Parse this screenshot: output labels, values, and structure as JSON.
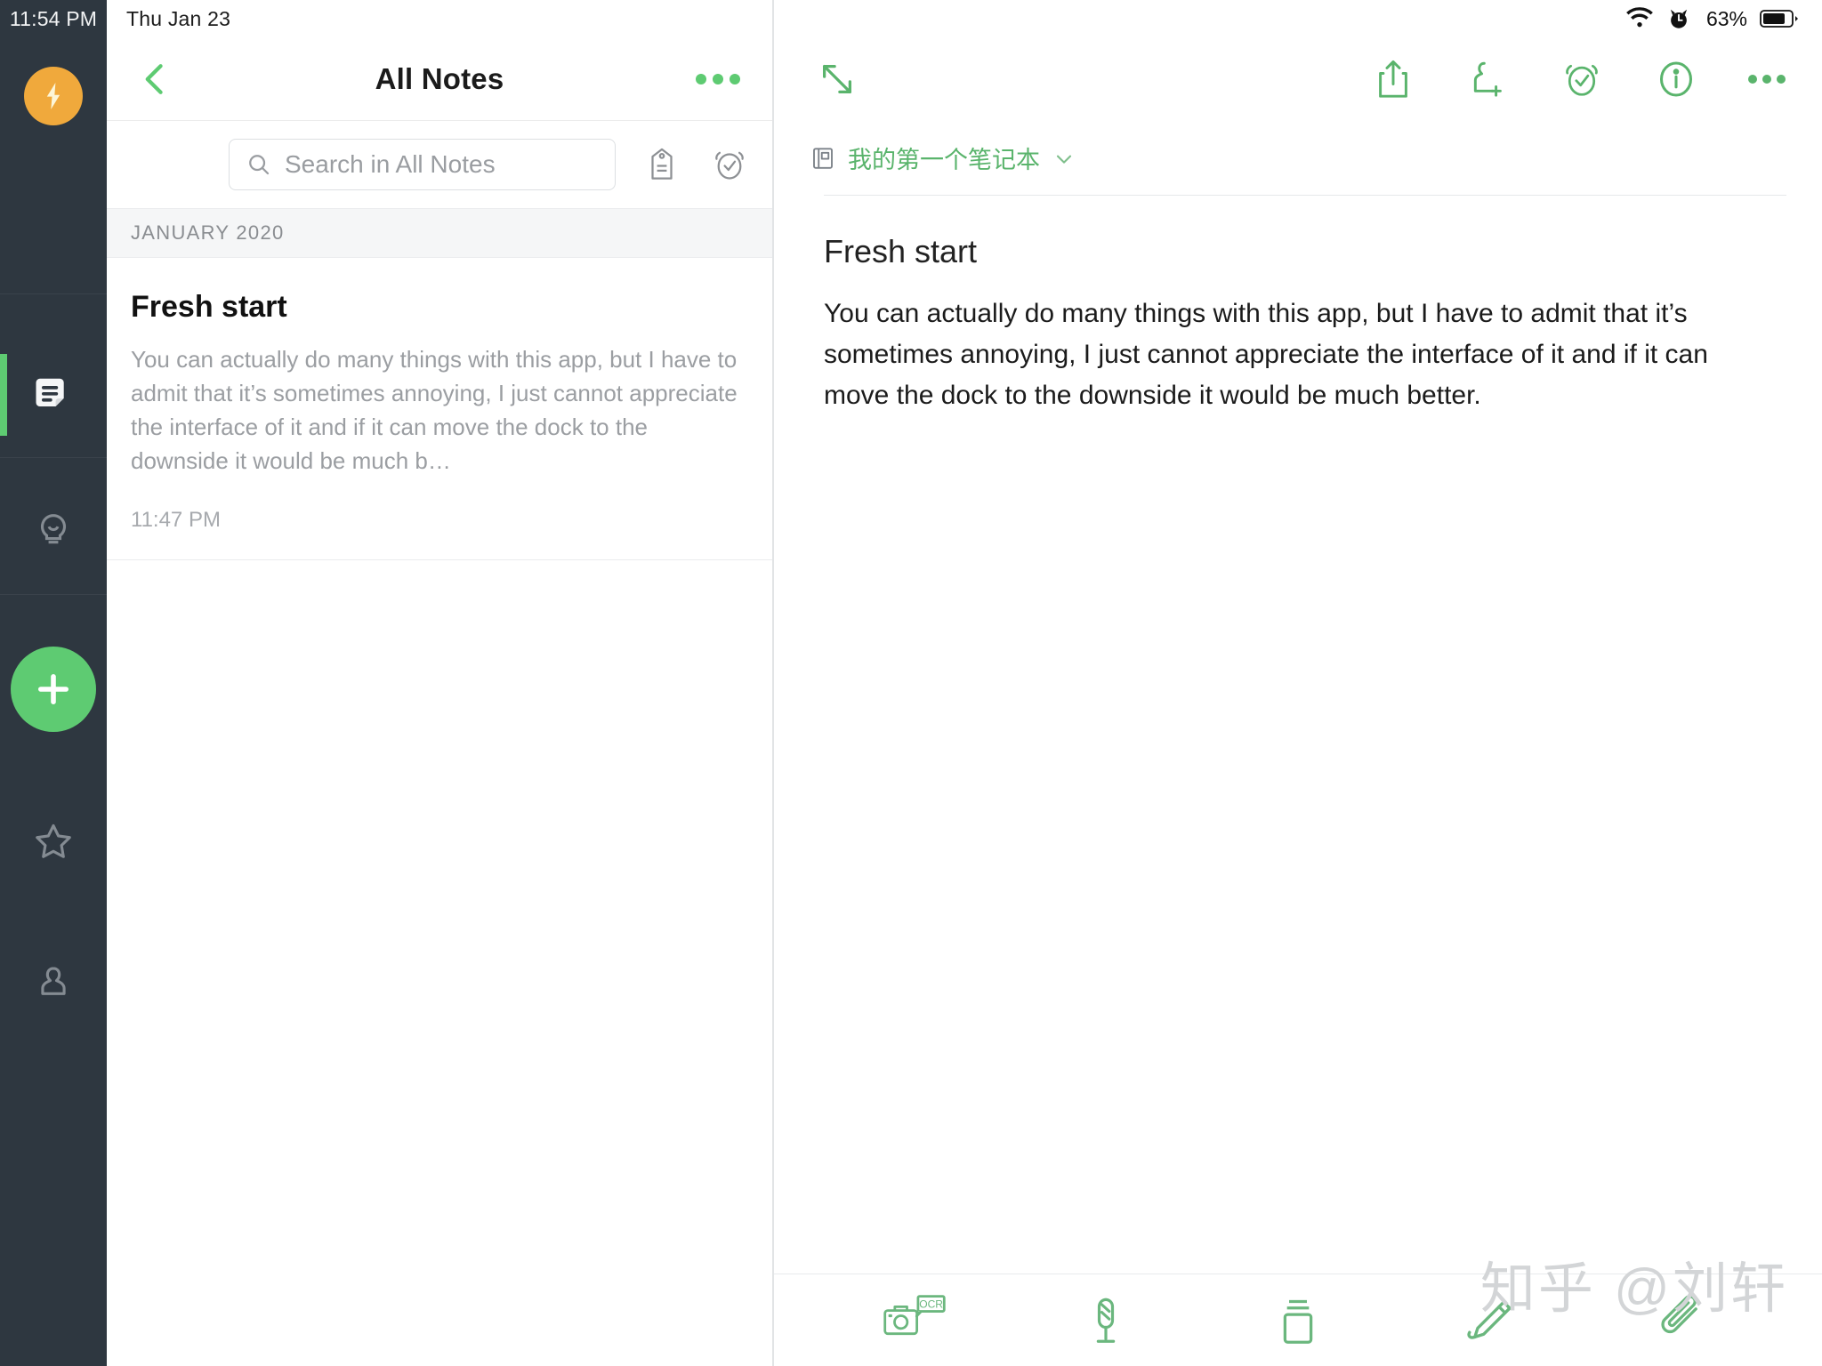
{
  "status_bar": {
    "time": "11:54 PM",
    "date": "Thu Jan 23",
    "battery_percent": "63%",
    "wifi_icon": "wifi-icon",
    "alarm_icon": "alarm-icon",
    "battery_icon": "battery-icon"
  },
  "rail": {
    "logo_icon": "lightning-bolt-logo",
    "items": [
      {
        "name": "notes",
        "icon": "note-document-icon",
        "active": true
      },
      {
        "name": "ideas",
        "icon": "lightbulb-icon",
        "active": false
      },
      {
        "name": "new-note",
        "icon": "plus-icon",
        "active": false
      },
      {
        "name": "shortcuts",
        "icon": "star-icon",
        "active": false
      },
      {
        "name": "account",
        "icon": "person-icon",
        "active": false
      }
    ],
    "accent_color": "#5ecb72",
    "background_color": "#2e3740",
    "logo_color": "#f0a93c"
  },
  "list_pane": {
    "back_icon": "chevron-left-icon",
    "title": "All Notes",
    "more_icon": "more-horizontal-icon",
    "search": {
      "placeholder": "Search in All Notes",
      "value": "",
      "search_icon": "search-icon"
    },
    "tag_icon": "tag-icon",
    "reminder_icon": "alarm-check-icon",
    "month_header": "JANUARY 2020",
    "notes": [
      {
        "title": "Fresh start",
        "preview": "You can actually do many things with this app, but I have to admit that it’s sometimes annoying, I just cannot appreciate the interface of it and if it can move the dock to the downside it would be much b…",
        "time": "11:47 PM"
      }
    ]
  },
  "editor_pane": {
    "toolbar": {
      "expand_icon": "expand-diagonal-icon",
      "share_icon": "share-upload-icon",
      "add_person_icon": "add-person-icon",
      "reminder_icon": "alarm-check-icon",
      "info_icon": "info-circle-icon",
      "more_icon": "more-horizontal-icon"
    },
    "notebook": {
      "icon": "notebook-icon",
      "name": "我的第一个笔记本",
      "chevron_icon": "chevron-down-icon"
    },
    "note": {
      "title": "Fresh start",
      "body": "You can actually do many things with this app, but I have to admit that it’s sometimes annoying, I just cannot appreciate the interface of it and if it can move the dock to the downside it would be much better."
    },
    "bottom_toolbar": [
      {
        "name": "camera-ocr",
        "icon": "camera-ocr-icon",
        "badge": "OCR"
      },
      {
        "name": "audio-record",
        "icon": "microphone-icon",
        "badge": ""
      },
      {
        "name": "note-card",
        "icon": "card-stack-icon",
        "badge": ""
      },
      {
        "name": "handwriting",
        "icon": "pencil-icon",
        "badge": ""
      },
      {
        "name": "attachment",
        "icon": "paperclip-icon",
        "badge": ""
      }
    ],
    "accent_color": "#5ab46c"
  },
  "watermark": {
    "text": "知乎 @刘轩"
  }
}
